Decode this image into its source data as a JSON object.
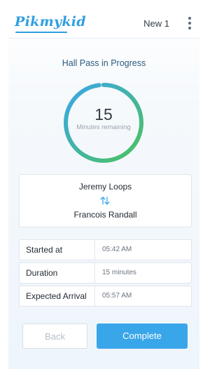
{
  "header": {
    "logo_text": "Pikmykid",
    "class_name": "New 1",
    "menu_icon": "more-vertical-icon"
  },
  "hall_pass": {
    "title": "Hall Pass in Progress",
    "remaining_value": "15",
    "remaining_caption": "Minutes remaining",
    "progress_fraction": 0.98,
    "gradient_start": "#4cc35e",
    "gradient_end": "#3aa6ea"
  },
  "pair": {
    "from": "Jeremy Loops",
    "swap_icon": "swap-arrows-icon",
    "to": "Francois Randall"
  },
  "details": [
    {
      "label": "Started at",
      "value": "05:42 AM"
    },
    {
      "label": "Duration",
      "value": "15 minutes"
    },
    {
      "label": "Expected Arrival",
      "value": "05:57 AM"
    }
  ],
  "actions": {
    "back_label": "Back",
    "complete_label": "Complete",
    "accent": "#3aa6ea"
  }
}
